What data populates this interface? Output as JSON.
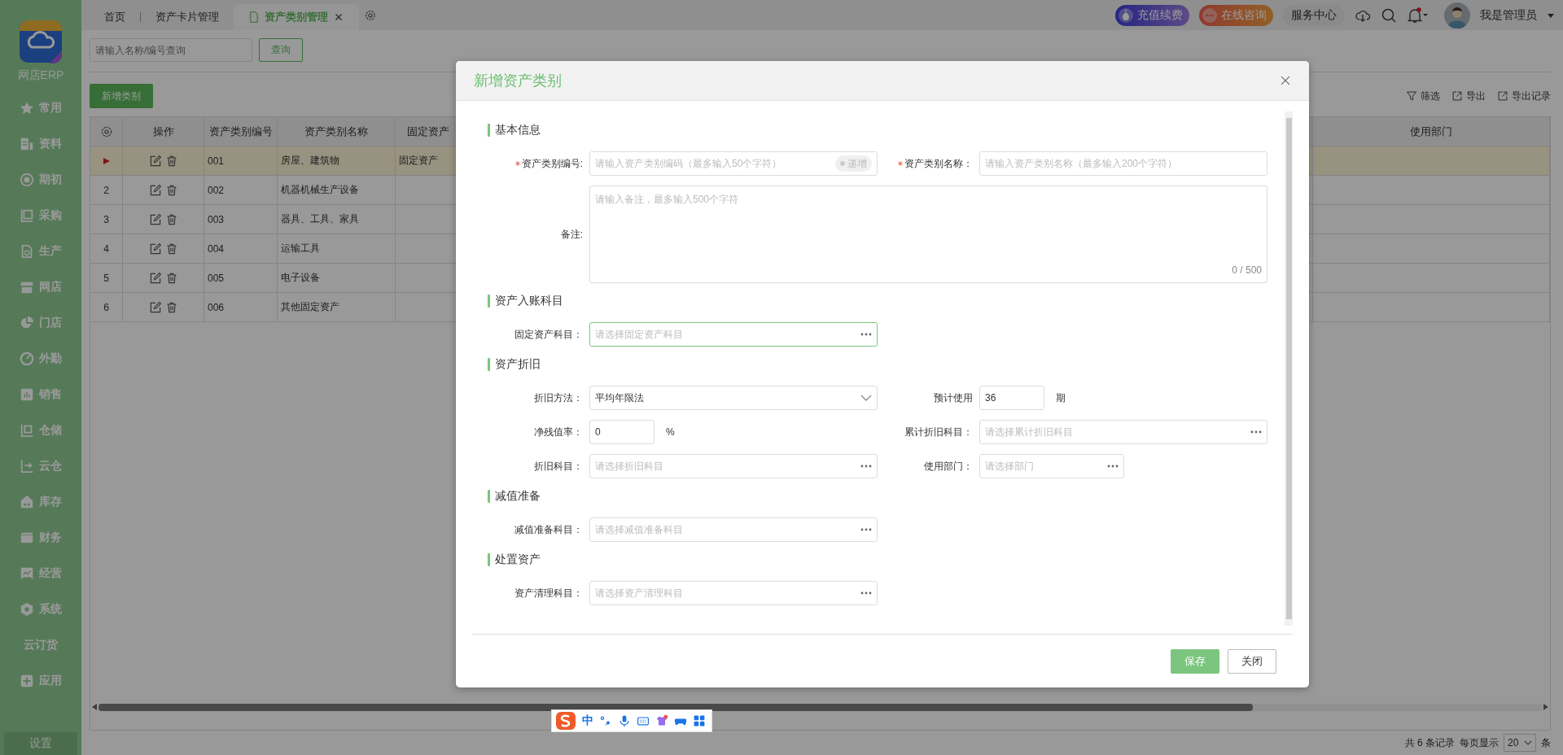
{
  "sidebar": {
    "logo_caption": "网店ERP",
    "items": [
      {
        "label": "常用"
      },
      {
        "label": "资料"
      },
      {
        "label": "期初"
      },
      {
        "label": "采购"
      },
      {
        "label": "生产"
      },
      {
        "label": "网店"
      },
      {
        "label": "门店"
      },
      {
        "label": "外勤"
      },
      {
        "label": "销售"
      },
      {
        "label": "仓储"
      },
      {
        "label": "云仓"
      },
      {
        "label": "库存"
      },
      {
        "label": "财务"
      },
      {
        "label": "经营"
      },
      {
        "label": "系统"
      },
      {
        "label": "云订货"
      },
      {
        "label": "应用"
      }
    ],
    "settings_label": "设置"
  },
  "top_tabs": [
    {
      "label": "首页",
      "selected": false
    },
    {
      "label": "资产卡片管理",
      "selected": false
    },
    {
      "label": "资产类别管理",
      "selected": true
    }
  ],
  "header": {
    "recharge": "充值续费",
    "consult": "在线咨询",
    "service": "服务中心",
    "user": "我是管理员"
  },
  "toolbar": {
    "search_placeholder": "请输入名称/编号查询",
    "query_label": "查询",
    "add_label": "新增类别",
    "actions": [
      "筛选",
      "导出",
      "导出记录"
    ]
  },
  "table": {
    "columns": [
      "操作",
      "资产类别编号",
      "资产类别名称",
      "固定资产",
      "使用部门"
    ],
    "rows": [
      {
        "selected": true,
        "code": "001",
        "name": "房屋、建筑物",
        "fixed_asset": "固定资产"
      },
      {
        "number": "2",
        "selected": false,
        "code": "002",
        "name": "机器机械生产设备"
      },
      {
        "number": "3",
        "selected": false,
        "code": "003",
        "name": "器具、工具、家具"
      },
      {
        "number": "4",
        "selected": false,
        "code": "004",
        "name": "运输工具"
      },
      {
        "number": "5",
        "selected": false,
        "code": "005",
        "name": "电子设备"
      },
      {
        "number": "6",
        "selected": false,
        "code": "006",
        "name": "其他固定资产"
      }
    ]
  },
  "pagination": {
    "total": "共 6 条记录",
    "per_page_label": "每页显示",
    "per_page": "20",
    "unit": "条"
  },
  "dialog": {
    "title": "新增资产类别",
    "sections": [
      {
        "title": "基本信息",
        "rows": [
          [
            {
              "kind": "text",
              "label": "资产类别编号:",
              "required": true,
              "focused": false,
              "placeholder": "请输入资产类别编码（最多输入50个字符）",
              "toggle": "递增"
            },
            {
              "kind": "text",
              "label": "资产类别名称：",
              "required": true,
              "focused": false,
              "placeholder": "请输入资产类别名称（最多输入200个字符）"
            }
          ],
          [
            {
              "kind": "textarea",
              "label": "备注:",
              "required": false,
              "focused": false,
              "placeholder": "请输入备注，最多输入500个字符",
              "counter": "0 / 500"
            }
          ]
        ]
      },
      {
        "title": "资产入账科目",
        "rows": [
          [
            {
              "kind": "picker",
              "label": "固定资产科目：",
              "required": false,
              "focused": true,
              "placeholder": "请选择固定资产科目"
            }
          ]
        ]
      },
      {
        "title": "资产折旧",
        "rows": [
          [
            {
              "kind": "select",
              "label": "折旧方法：",
              "required": false,
              "focused": false,
              "value": "平均年限法"
            },
            {
              "kind": "number",
              "label": "预计使用",
              "required": false,
              "focused": false,
              "value": "36",
              "unit": "期"
            }
          ],
          [
            {
              "kind": "number",
              "label": "净残值率：",
              "required": false,
              "focused": false,
              "value": "0",
              "unit": "%"
            },
            {
              "kind": "picker",
              "label": "累计折旧科目：",
              "required": false,
              "focused": false,
              "placeholder": "请选择累计折旧科目"
            }
          ],
          [
            {
              "kind": "picker",
              "label": "折旧科目：",
              "required": false,
              "focused": false,
              "placeholder": "请选择折旧科目"
            },
            {
              "kind": "short-picker",
              "label": "使用部门：",
              "required": false,
              "focused": false,
              "placeholder": "请选择部门"
            }
          ]
        ]
      },
      {
        "title": "减值准备",
        "rows": [
          [
            {
              "kind": "picker",
              "label": "减值准备科目：",
              "required": false,
              "focused": false,
              "placeholder": "请选择减值准备科目"
            }
          ]
        ]
      },
      {
        "title": "处置资产",
        "rows": [
          [
            {
              "kind": "picker",
              "label": "资产清理科目：",
              "required": false,
              "focused": false,
              "placeholder": "请选择资产清理科目"
            }
          ]
        ]
      }
    ],
    "buttons": [
      {
        "label": "保存",
        "kind": "primary"
      },
      {
        "label": "关闭",
        "kind": "default"
      }
    ]
  },
  "ime_toolbar": {
    "mode": "中"
  }
}
